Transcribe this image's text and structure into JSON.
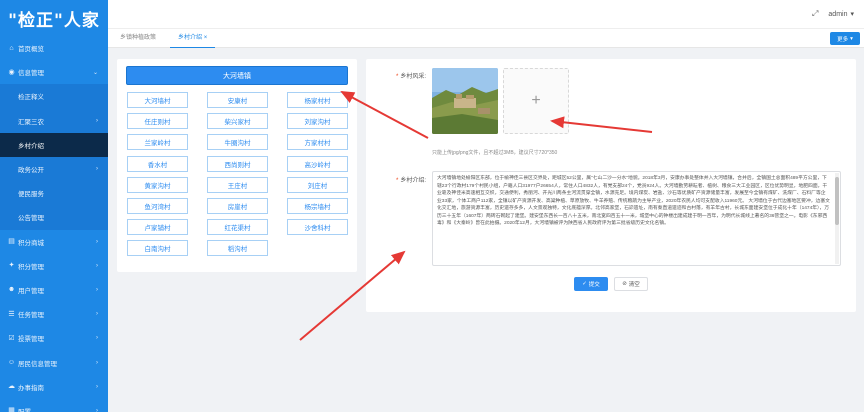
{
  "app": {
    "logo": "\"检正\"人家"
  },
  "sidebar": {
    "items": [
      {
        "label": "首页概览",
        "icon": "home-icon",
        "glyph": "⌂",
        "type": "top"
      },
      {
        "label": "信息管理",
        "icon": "info-icon",
        "glyph": "◉",
        "type": "top",
        "expanded": true
      },
      {
        "label": "检正释义",
        "type": "sub"
      },
      {
        "label": "汇聚三农",
        "type": "sub",
        "hasChild": true
      },
      {
        "label": "乡村介绍",
        "type": "sub",
        "active": true
      },
      {
        "label": "政务公开",
        "type": "sub",
        "hasChild": true
      },
      {
        "label": "便民服务",
        "type": "sub"
      },
      {
        "label": "公告管理",
        "type": "sub"
      },
      {
        "label": "积分商城",
        "icon": "mall-icon",
        "glyph": "▤",
        "type": "top",
        "hasChild": true
      },
      {
        "label": "积分管理",
        "icon": "points-icon",
        "glyph": "✦",
        "type": "top",
        "hasChild": true
      },
      {
        "label": "用户管理",
        "icon": "user-icon",
        "glyph": "☻",
        "type": "top",
        "hasChild": true
      },
      {
        "label": "任务管理",
        "icon": "task-icon",
        "glyph": "☰",
        "type": "top",
        "hasChild": true
      },
      {
        "label": "投票管理",
        "icon": "vote-icon",
        "glyph": "☑",
        "type": "top",
        "hasChild": true
      },
      {
        "label": "居民信息管理",
        "icon": "resident-icon",
        "glyph": "☺",
        "type": "top",
        "hasChild": true
      },
      {
        "label": "办事指南",
        "icon": "guide-icon",
        "glyph": "☁",
        "type": "top",
        "hasChild": true
      },
      {
        "label": "配置",
        "icon": "config-icon",
        "glyph": "▦",
        "type": "top",
        "hasChild": true
      }
    ]
  },
  "topbar": {
    "user": "admin",
    "fullscreen_icon": "fullscreen-icon"
  },
  "tabs": {
    "items": [
      "乡镇种植政策",
      "乡村介绍"
    ],
    "more": "更多"
  },
  "town": {
    "name": "大河墙镇"
  },
  "villages": [
    "大河墙村",
    "安康村",
    "杨家村村",
    "任庄则村",
    "柴兴家村",
    "刘家沟村",
    "兰家岭村",
    "牛圈沟村",
    "方家村村",
    "香水村",
    "西尚则村",
    "高沙岭村",
    "黄家沟村",
    "王庄村",
    "刘庄村",
    "鱼河湾村",
    "房崖村",
    "杨宗墙村",
    "卢家铺村",
    "红花渠村",
    "沙舍科村",
    "白南沟村",
    "稻沟村"
  ],
  "form": {
    "scenery_label": "乡村风采:",
    "intro_label": "乡村介绍:",
    "upload_plus": "+",
    "hint": "只能上传jpg/png文件，且不超过3MB，建议尺寸720*350",
    "intro_text": "大河墙镇地处榆阳区东部，位于榆神佳三县区交界处，距城区52公里，属\"七山二沙一分水\"地貌。2018年3月，安康办事处整体并入大河墙镇，合并后，全镇国土总面积489平方公里，下辖23个行政村179个村民小组，户籍人口31977户26654人，常住人口4832人，有党支部24个，党员924人。大河墙勤劳耕耘者、植树、粮食三大工业园区，区位优势明显，地肥四面，干业靠及神佳米高速相互交织，交通便利，秀丽河、开光川两条主河流贯穿全镇，水源充足。境内煤炭、岩盐、沙石等优质矿产资源储量丰富，发展至今全镇有煤矿、洗煤厂、石料厂等企业33家，个体工商户112家，全镇以矿产资源开发、高粱种植、草原放牧、牛羊养殖、传统粮蔬为主导产业，2020年农民人均可支配收入11960元。 大河墙位于古代边塞地区要冲，边塞文化交汇地，旅游资源丰富，历史遗存多多，人文景观独特，文化底蕴深厚。北邻高家堡，石峁遗址，南有秦直道遗迹和古村落，有羊年古村，长城东面建安堡位于成化十年（1474年），万历三十五年（1607年）两砖石砌起了建堡。建安堡东西长一百八十五米，南北宽四百五十一米，城堡中心的钟楼出建成建于明一百年，为明代长城线上著名的36营堡之一。电影《东邪西毒》和《大秦岭》曾在此拍摄。2020年12月，大河墙镇被评为陕西省人民政府评为第三批省级历史文化名镇。",
    "submit": "提交",
    "clear": "清空"
  },
  "colors": {
    "sidebar": "#1e88e5",
    "active_menu": "#0c2a4a",
    "primary": "#2d8cf0",
    "arrow": "#e53935"
  }
}
